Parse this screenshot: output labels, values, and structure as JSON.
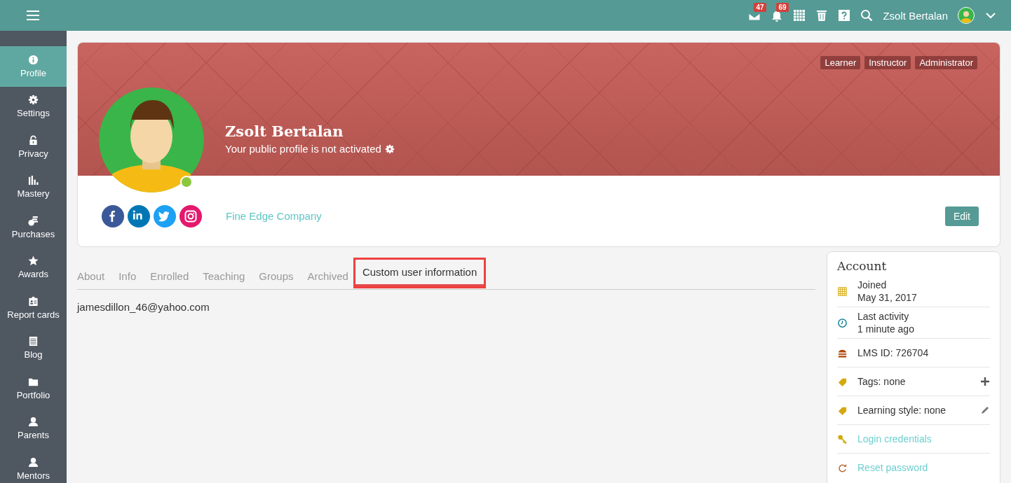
{
  "topbar": {
    "notifications": [
      {
        "kind": "mail",
        "count": "47"
      },
      {
        "kind": "bell",
        "count": "69"
      }
    ],
    "user_name": "Zsolt Bertalan"
  },
  "sidebar": {
    "items": [
      {
        "kind": "info",
        "label": "Profile",
        "selected": true
      },
      {
        "kind": "gear",
        "label": "Settings",
        "selected": false
      },
      {
        "kind": "lock",
        "label": "Privacy",
        "selected": false
      },
      {
        "kind": "bars",
        "label": "Mastery",
        "selected": false
      },
      {
        "kind": "coins",
        "label": "Purchases",
        "selected": false
      },
      {
        "kind": "star",
        "label": "Awards",
        "selected": false
      },
      {
        "kind": "badge",
        "label": "Report cards",
        "selected": false
      },
      {
        "kind": "notepad",
        "label": "Blog",
        "selected": false
      },
      {
        "kind": "folder",
        "label": "Portfolio",
        "selected": false
      },
      {
        "kind": "person",
        "label": "Parents",
        "selected": false
      },
      {
        "kind": "person",
        "label": "Mentors",
        "selected": false
      }
    ]
  },
  "profile": {
    "roles": [
      "Learner",
      "Instructor",
      "Administrator"
    ],
    "name": "Zsolt Bertalan",
    "public_status": "Your public profile is not activated",
    "online": true,
    "social": [
      {
        "kind": "facebook",
        "color": "#3b5998"
      },
      {
        "kind": "linkedin",
        "color": "#0077b5"
      },
      {
        "kind": "twitter",
        "color": "#1da1f2"
      },
      {
        "kind": "instagram",
        "color": "#e4186d"
      }
    ],
    "company": "Fine Edge Company",
    "edit_button": "Edit"
  },
  "tabs": [
    {
      "label": "About",
      "selected": false,
      "highlighted": false
    },
    {
      "label": "Info",
      "selected": false,
      "highlighted": false
    },
    {
      "label": "Enrolled",
      "selected": false,
      "highlighted": false
    },
    {
      "label": "Teaching",
      "selected": false,
      "highlighted": false
    },
    {
      "label": "Groups",
      "selected": false,
      "highlighted": false
    },
    {
      "label": "Archived",
      "selected": false,
      "highlighted": false
    },
    {
      "label": "Custom user information",
      "selected": true,
      "highlighted": true
    }
  ],
  "tab_content": "jamesdillon_46@yahoo.com",
  "account": {
    "title": "Account",
    "rows": [
      {
        "kind": "calendar",
        "label": "Joined",
        "value": "May 31, 2017"
      },
      {
        "kind": "clock",
        "label": "Last activity",
        "value": "1 minute ago"
      },
      {
        "kind": "stack",
        "label": "LMS ID: 726704"
      },
      {
        "kind": "tag-add",
        "label": "Tags: none"
      },
      {
        "kind": "tag-edit",
        "label": "Learning style: none"
      },
      {
        "kind": "key",
        "label": "Login credentials",
        "link": true
      },
      {
        "kind": "reset",
        "label": "Reset password",
        "link": true
      }
    ]
  }
}
